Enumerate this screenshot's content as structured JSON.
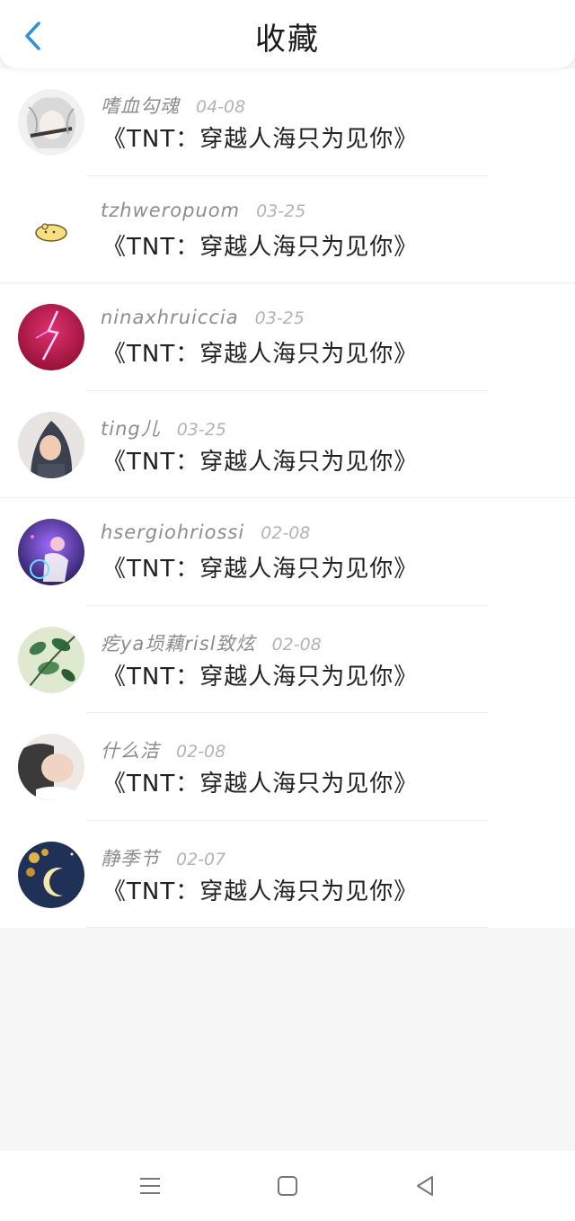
{
  "header": {
    "title": "收藏",
    "back_icon": "chevron-left-icon",
    "accent": "#2f8fd8"
  },
  "favorites": [
    {
      "username": "嗜血勾魂",
      "date": "04-08",
      "song": "《TNT：穿越人海只为见你》"
    },
    {
      "username": "tzhweropuom",
      "date": "03-25",
      "song": "《TNT：穿越人海只为见你》"
    },
    {
      "username": "ninaxhruiccia",
      "date": "03-25",
      "song": "《TNT：穿越人海只为见你》"
    },
    {
      "username": "ting儿",
      "date": "03-25",
      "song": "《TNT：穿越人海只为见你》"
    },
    {
      "username": "hsergiohriossi",
      "date": "02-08",
      "song": "《TNT：穿越人海只为见你》"
    },
    {
      "username": "疙ya埙藕risl致炫",
      "date": "02-08",
      "song": "《TNT：穿越人海只为见你》"
    },
    {
      "username": "什么洁",
      "date": "02-08",
      "song": "《TNT：穿越人海只为见你》"
    },
    {
      "username": "静季节",
      "date": "02-07",
      "song": "《TNT：穿越人海只为见你》"
    }
  ],
  "navbar": {
    "icons": [
      "menu-icon",
      "home-square-icon",
      "back-triangle-icon"
    ]
  }
}
